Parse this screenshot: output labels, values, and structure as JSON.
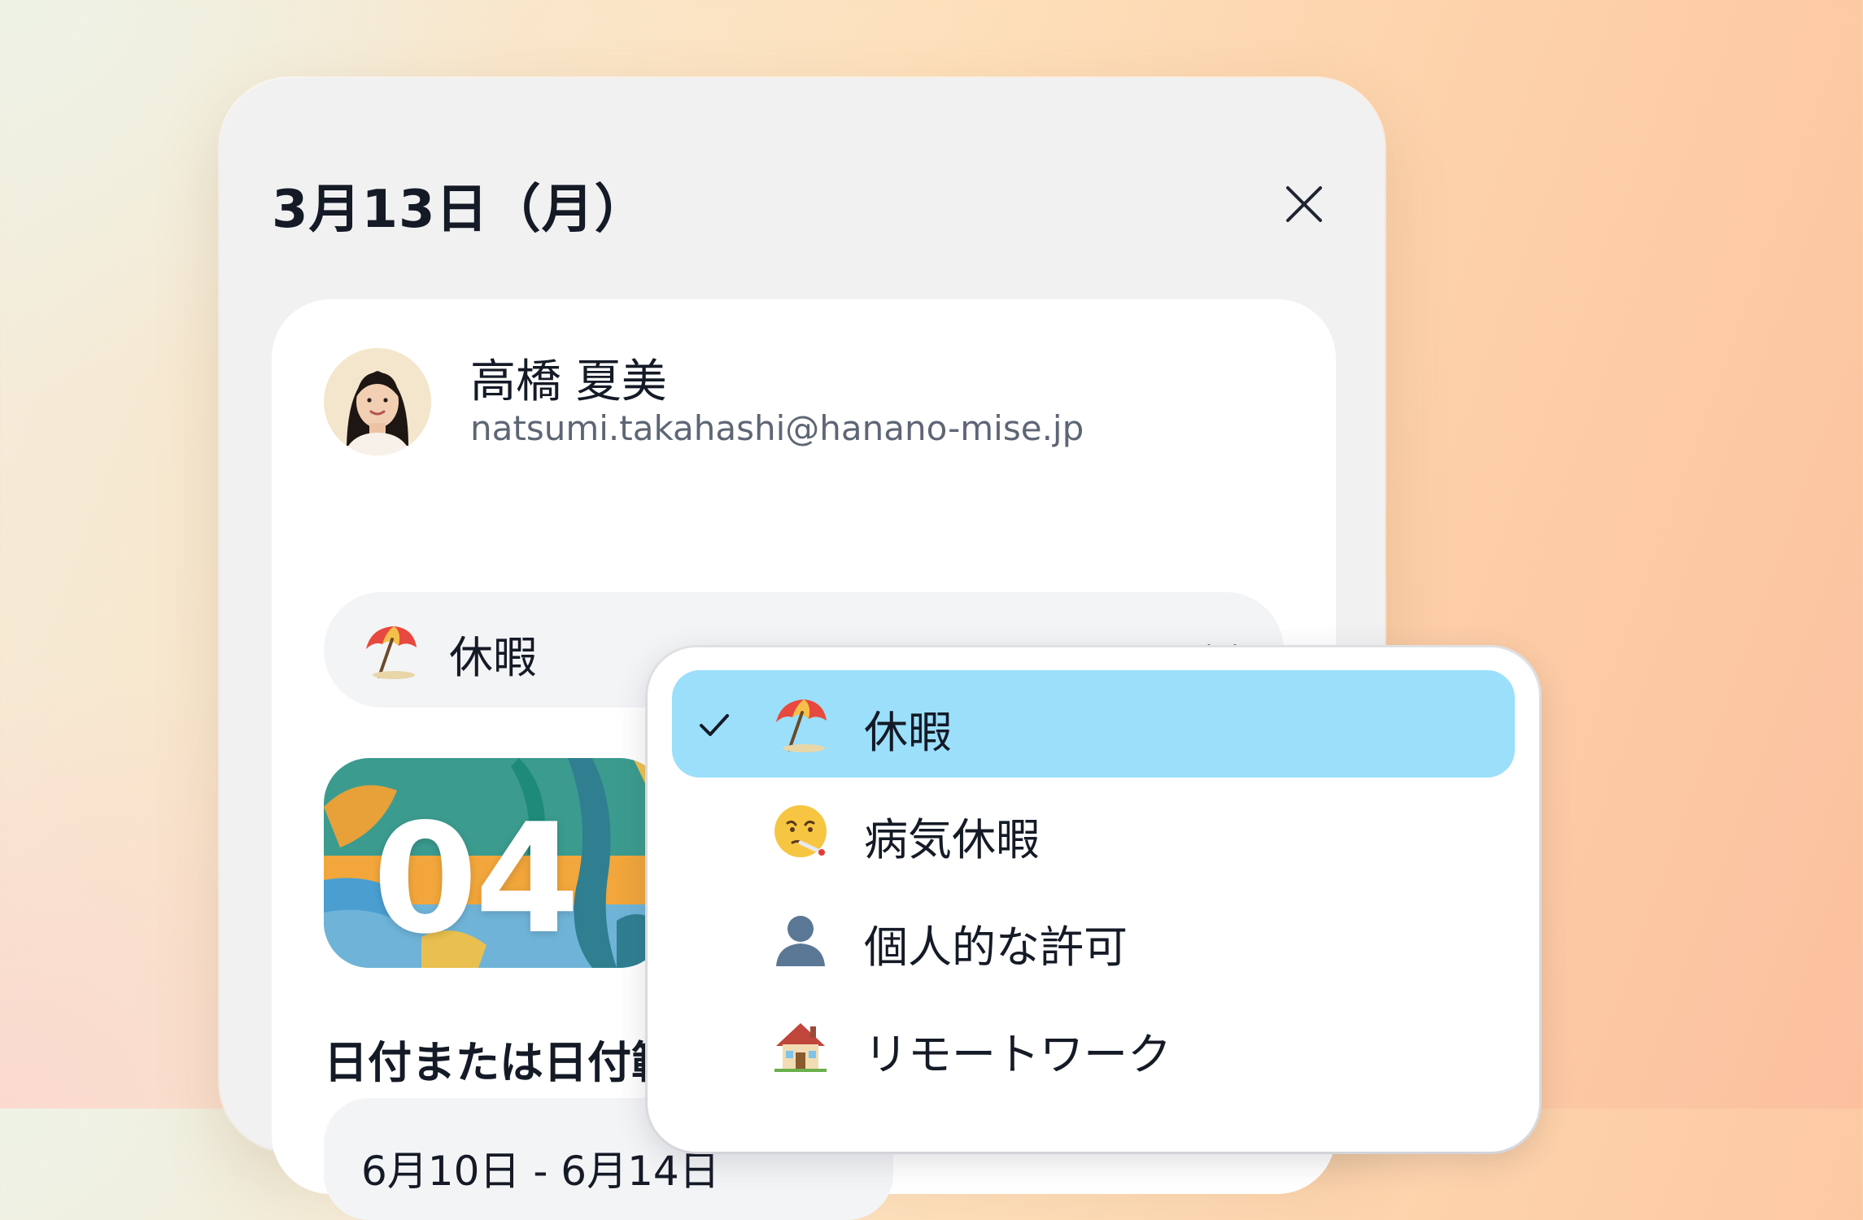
{
  "dialog": {
    "title": "3月13日（月）",
    "close_icon": "close-icon"
  },
  "user": {
    "name": "高橋 夏美",
    "email": "natsumi.takahashi@hanano-mise.jp"
  },
  "leave_type_select": {
    "selected_label": "休暇",
    "icon": "beach-umbrella-icon",
    "chevron": "chevron-down-icon"
  },
  "banner": {
    "number": "04"
  },
  "date_section": {
    "label": "日付または日付範囲",
    "value": "6月10日 - 6月14日"
  },
  "dropdown": {
    "options": [
      {
        "label": "休暇",
        "icon": "beach-umbrella-icon",
        "selected": true
      },
      {
        "label": "病気休暇",
        "icon": "sick-face-icon",
        "selected": false
      },
      {
        "label": "個人的な許可",
        "icon": "person-silhouette-icon",
        "selected": false
      },
      {
        "label": "リモートワーク",
        "icon": "house-icon",
        "selected": false
      }
    ]
  },
  "colors": {
    "selected_option_bg": "#9bdffb",
    "card_bg": "#ffffff",
    "modal_bg": "#f1f1f2"
  }
}
